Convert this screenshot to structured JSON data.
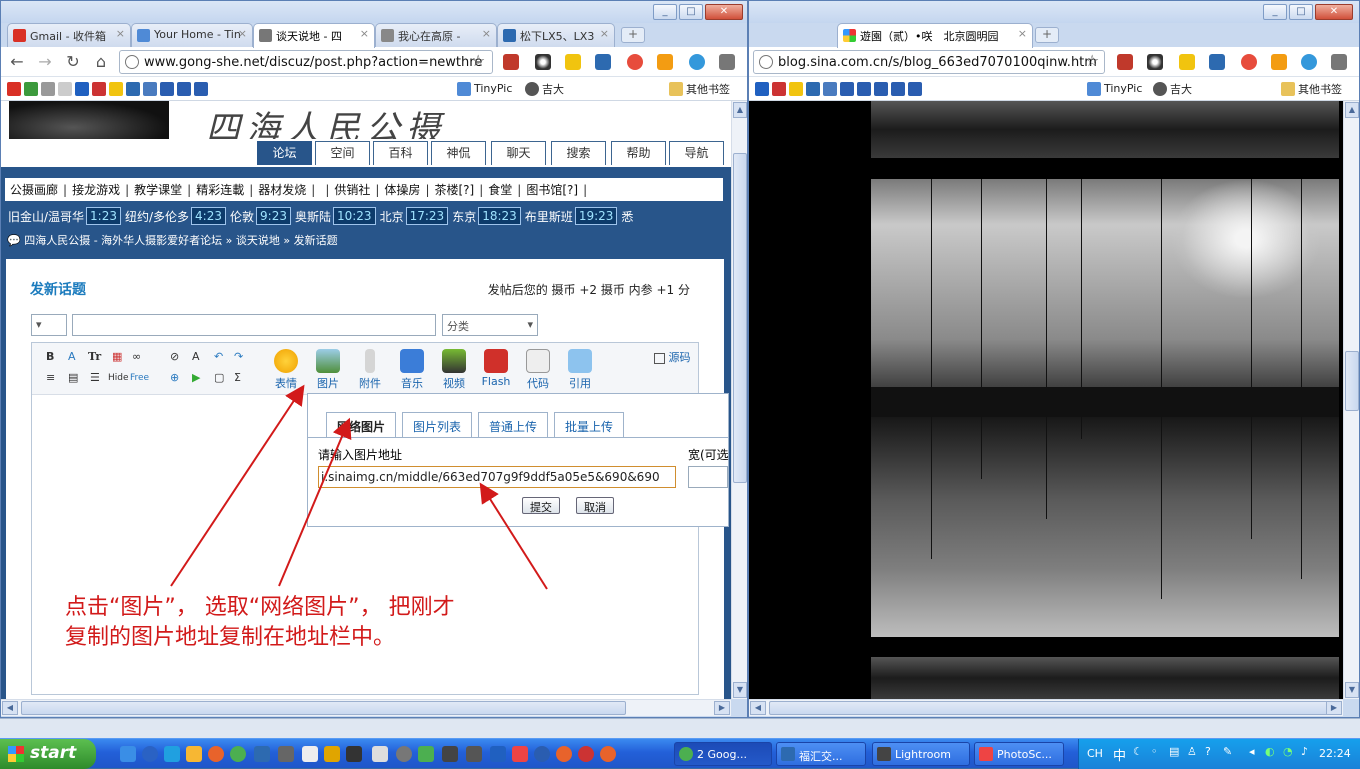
{
  "left_window": {
    "tabs": [
      {
        "label": "Gmail - 收件箱",
        "color": "#d93025"
      },
      {
        "label": "Your Home - Tin",
        "color": "#4f8ad6"
      },
      {
        "label": "谈天说地 - 四",
        "color": "#666666"
      },
      {
        "label": "我心在高原 - ",
        "color": "#666666"
      },
      {
        "label": "松下LX5、LX3",
        "color": "#2d6ab0"
      }
    ],
    "url": "www.gong-she.net/discuz/post.php?action=newthre",
    "bookmarks": [
      "TinyPic",
      "吉大",
      "其他书签"
    ]
  },
  "right_window": {
    "tabs": [
      {
        "label": "遊園（贰）•咲　北京圆明园",
        "color": "#e33b2e"
      }
    ],
    "url": "blog.sina.com.cn/s/blog_663ed7070100qinw.htm",
    "bookmarks": [
      "TinyPic",
      "吉大",
      "其他书签"
    ]
  },
  "forum": {
    "nav_tabs": [
      "论坛",
      "空间",
      "百科",
      "神侃",
      "聊天",
      "搜索",
      "帮助",
      "导航"
    ],
    "active_tab": "论坛",
    "categories": [
      "公摄画廊",
      "接龙游戏",
      "教学课堂",
      "精彩连載",
      "器材发烧",
      "",
      "供销社",
      "体操房",
      "茶楼[?]",
      "食堂",
      "图书馆[?]"
    ],
    "clocks": [
      {
        "city": "旧金山/温哥华",
        "time": "1:23"
      },
      {
        "city": "纽约/多伦多",
        "time": "4:23"
      },
      {
        "city": "伦敦",
        "time": "9:23"
      },
      {
        "city": "奥斯陆",
        "time": "10:23"
      },
      {
        "city": "北京",
        "time": "17:23"
      },
      {
        "city": "东京",
        "time": "18:23"
      },
      {
        "city": "布里斯班",
        "time": "19:23"
      },
      {
        "city": "悉",
        "time": ""
      }
    ],
    "breadcrumb": "四海人民公摄 - 海外华人摄影爱好者论坛 » 谈天说地 » 发新话题",
    "post_title": "发新话题",
    "post_note": "发帖后您的 摄币 +2 摄币  内参 +1 分",
    "category_placeholder": "分类",
    "source_label": "源码",
    "editor_big_icons": [
      "表情",
      "图片",
      "附件",
      "音乐",
      "视频",
      "Flash",
      "代码",
      "引用"
    ],
    "popup": {
      "tabs": [
        "网络图片",
        "图片列表",
        "普通上传",
        "批量上传"
      ],
      "url_label": "请输入图片地址",
      "width_label": "宽(可选",
      "url_value": "i.sinaimg.cn/middle/663ed707g9f9ddf5a05e5&690&690",
      "submit": "提交",
      "cancel": "取消"
    },
    "annotation": [
      "点击“图片”， 选取“网络图片”， 把刚才",
      "复制的图片地址复制在地址栏中。"
    ]
  },
  "taskbar": {
    "start": "start",
    "tasks": [
      "2 Goog...",
      "福汇交...",
      "Lightroom",
      "PhotoSc..."
    ],
    "lang": "CH",
    "clock": "22:24"
  }
}
